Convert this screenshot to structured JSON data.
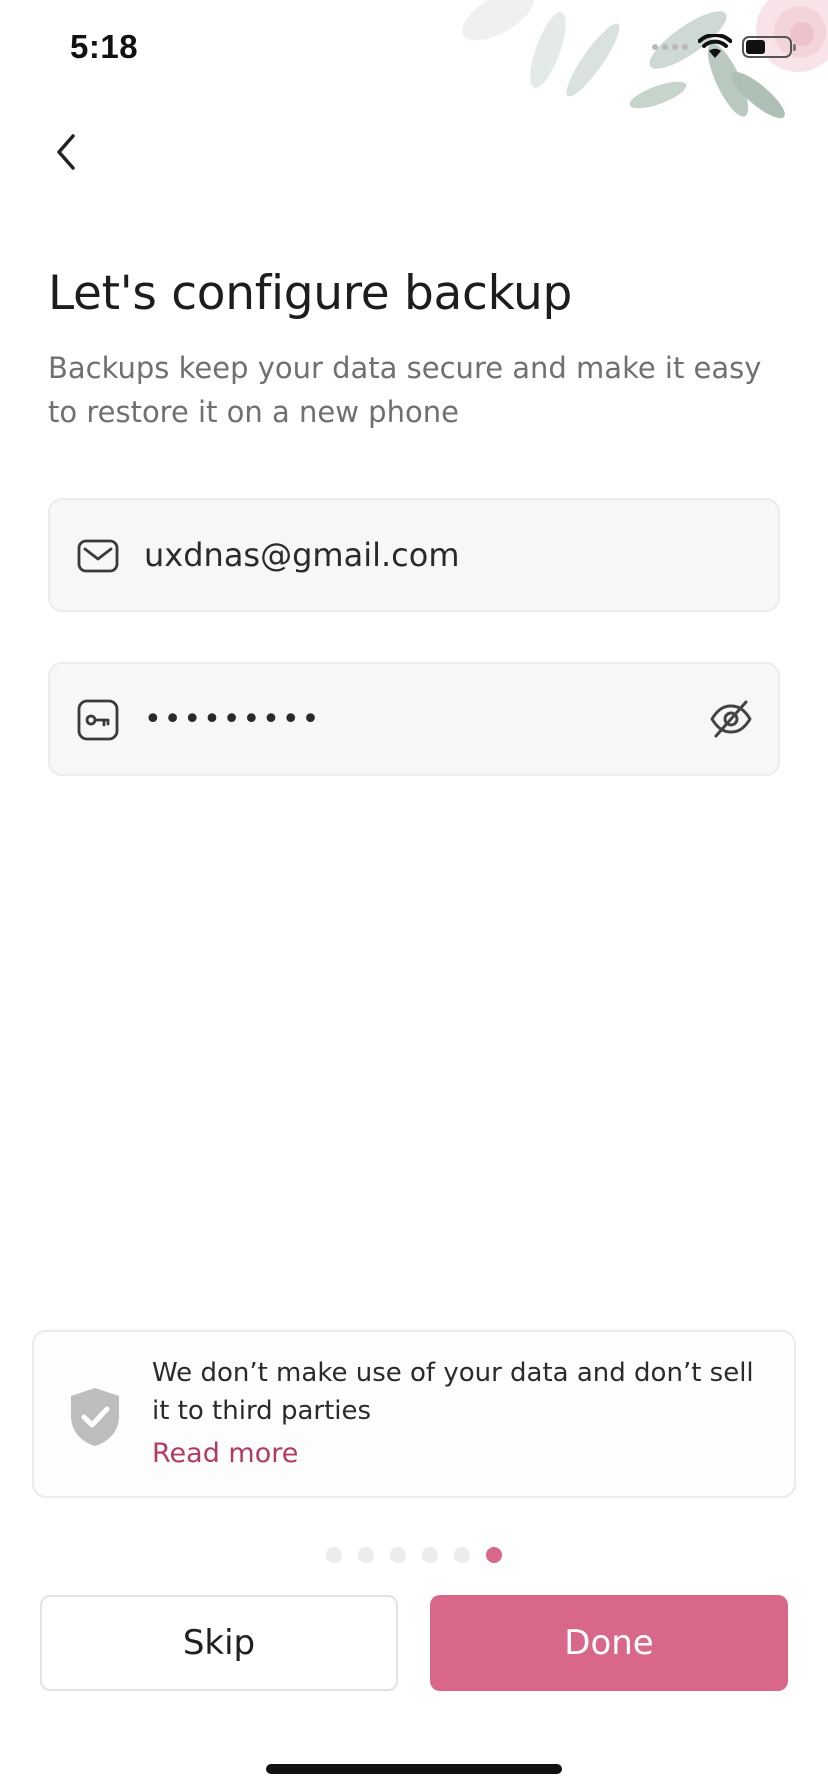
{
  "status_bar": {
    "time": "5:18",
    "battery_level": 0.45
  },
  "header": {
    "back_icon": "chevron-left-icon"
  },
  "page": {
    "title": "Let's configure backup",
    "subtitle": "Backups keep your data secure and make it easy to restore it on a new phone"
  },
  "form": {
    "email": {
      "icon": "mail-icon",
      "value": "uxdnas@gmail.com"
    },
    "password": {
      "icon": "key-icon",
      "value": "•••••••••",
      "toggle_icon": "eye-off-icon"
    }
  },
  "privacy_notice": {
    "icon": "shield-check-icon",
    "text": "We don’t make use of your data and don’t sell it to third parties",
    "link_label": "Read more"
  },
  "pager": {
    "total": 6,
    "current": 6
  },
  "actions": {
    "skip_label": "Skip",
    "done_label": "Done"
  },
  "colors": {
    "accent": "#d9678a",
    "link": "#b23a64",
    "field_background": "#f7f7f7"
  }
}
